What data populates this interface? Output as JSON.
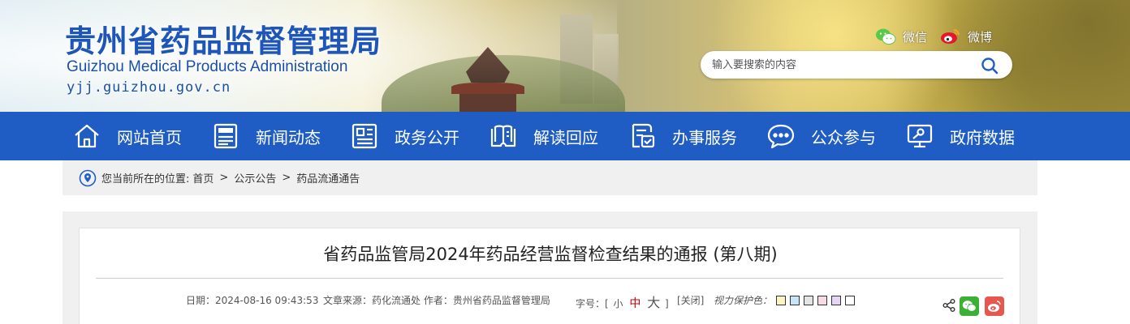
{
  "header": {
    "title": "贵州省药品监督管理局",
    "title_en": "Guizhou Medical Products Administration",
    "domain": "yjj.guizhou.gov.cn",
    "wechat_label": "微信",
    "weibo_label": "微博",
    "search_placeholder": "输入要搜索的内容"
  },
  "nav": {
    "items": [
      {
        "label": "网站首页",
        "icon": "home-icon"
      },
      {
        "label": "新闻动态",
        "icon": "news-icon"
      },
      {
        "label": "政务公开",
        "icon": "document-icon"
      },
      {
        "label": "解读回应",
        "icon": "book-icon"
      },
      {
        "label": "办事服务",
        "icon": "service-icon"
      },
      {
        "label": "公众参与",
        "icon": "chat-icon"
      },
      {
        "label": "政府数据",
        "icon": "data-icon"
      }
    ]
  },
  "breadcrumb": {
    "prefix": "您当前所在的位置:",
    "items": [
      "首页",
      "公示公告",
      "药品流通通告"
    ],
    "separator": ">"
  },
  "article": {
    "title": "省药品监管局2024年药品经营监督检查结果的通报 (第八期)",
    "date_label": "日期：2024-08-16 09:43:53",
    "source_label": "文章来源：药化流通处 作者：贵州省药品监督管理局",
    "font_size_label": "字号：[",
    "font_small": "小",
    "font_medium": "中",
    "font_large": "大",
    "font_close": "]",
    "close_label": "[关闭]",
    "eye_care_label": "视力保护色：",
    "swatch_colors": [
      "#fbf5c4",
      "#c8e4f6",
      "#e4e4e4",
      "#f6dbe4",
      "#e5d6f4",
      "#ffffff"
    ]
  },
  "colors": {
    "nav_bg": "#1f5dc4",
    "title_blue": "#1d56b8",
    "active_font": "#c00000",
    "wechat_green": "#3cb034",
    "weibo_red": "#e8574f"
  }
}
